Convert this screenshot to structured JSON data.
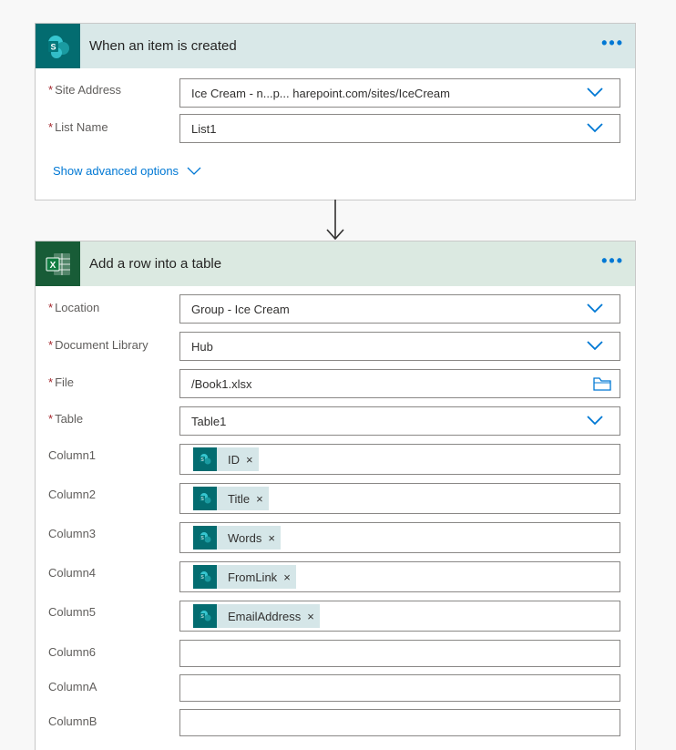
{
  "trigger": {
    "title": "When an item is created",
    "more_label": "•••",
    "icon": "sharepoint-icon",
    "fields": [
      {
        "label": "Site Address",
        "required": true,
        "value": "Ice Cream - n...p...        harepoint.com/sites/IceCream",
        "control": "dropdown"
      },
      {
        "label": "List Name",
        "required": true,
        "value": "List1",
        "control": "dropdown"
      }
    ],
    "advanced_label": "Show advanced options"
  },
  "action": {
    "title": "Add a row into a table",
    "more_label": "•••",
    "icon": "excel-icon",
    "fields": [
      {
        "label": "Location",
        "required": true,
        "value": "Group - Ice Cream",
        "control": "dropdown"
      },
      {
        "label": "Document Library",
        "required": true,
        "value": "Hub",
        "control": "dropdown"
      },
      {
        "label": "File",
        "required": true,
        "value": "/Book1.xlsx",
        "control": "folder"
      },
      {
        "label": "Table",
        "required": true,
        "value": "Table1",
        "control": "dropdown"
      }
    ],
    "columns": [
      {
        "label": "Column1",
        "token": "ID"
      },
      {
        "label": "Column2",
        "token": "Title"
      },
      {
        "label": "Column3",
        "token": "Words"
      },
      {
        "label": "Column4",
        "token": "FromLink"
      },
      {
        "label": "Column5",
        "token": "EmailAddress"
      },
      {
        "label": "Column6",
        "token": ""
      },
      {
        "label": "ColumnA",
        "token": ""
      },
      {
        "label": "ColumnB",
        "token": ""
      }
    ]
  },
  "required_marker": "*",
  "token_remove": "×",
  "colors": {
    "accent": "#0078d4",
    "sharepoint": "#036c70",
    "excel": "#185c37",
    "required": "#a4262c"
  }
}
